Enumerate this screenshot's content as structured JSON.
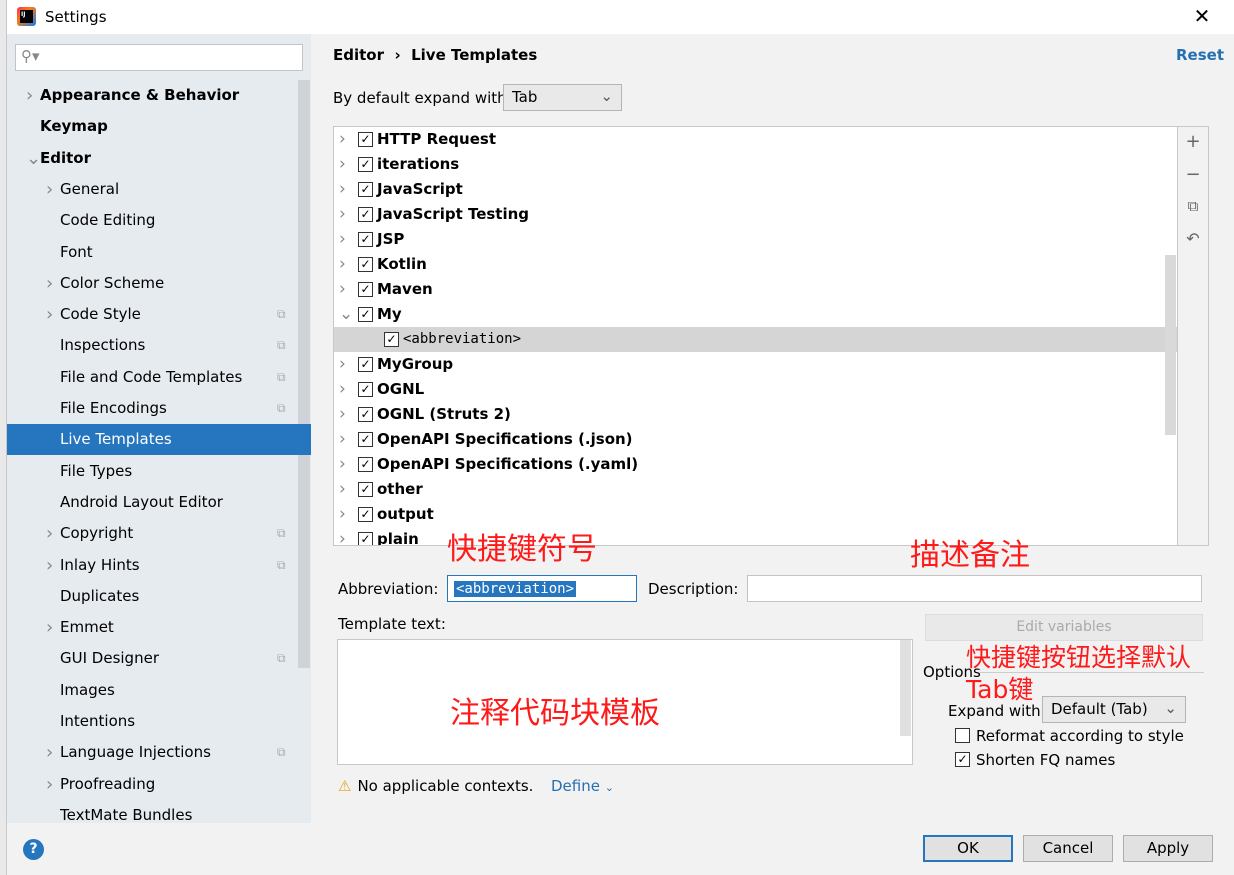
{
  "window": {
    "title": "Settings",
    "close": "✕"
  },
  "search": {
    "placeholder": "",
    "icon": "search-icon"
  },
  "sidebar": {
    "items": [
      {
        "label": "Appearance & Behavior",
        "level": 0,
        "bold": true,
        "arrow": "right"
      },
      {
        "label": "Keymap",
        "level": 0,
        "bold": true,
        "arrow": ""
      },
      {
        "label": "Editor",
        "level": 0,
        "bold": true,
        "arrow": "down"
      },
      {
        "label": "General",
        "level": 1,
        "arrow": "right"
      },
      {
        "label": "Code Editing",
        "level": 1,
        "arrow": ""
      },
      {
        "label": "Font",
        "level": 1,
        "arrow": ""
      },
      {
        "label": "Color Scheme",
        "level": 1,
        "arrow": "right"
      },
      {
        "label": "Code Style",
        "level": 1,
        "arrow": "right",
        "copy": true
      },
      {
        "label": "Inspections",
        "level": 1,
        "arrow": "",
        "copy": true
      },
      {
        "label": "File and Code Templates",
        "level": 1,
        "arrow": "",
        "copy": true
      },
      {
        "label": "File Encodings",
        "level": 1,
        "arrow": "",
        "copy": true
      },
      {
        "label": "Live Templates",
        "level": 1,
        "arrow": "",
        "selected": true
      },
      {
        "label": "File Types",
        "level": 1,
        "arrow": ""
      },
      {
        "label": "Android Layout Editor",
        "level": 1,
        "arrow": ""
      },
      {
        "label": "Copyright",
        "level": 1,
        "arrow": "right",
        "copy": true
      },
      {
        "label": "Inlay Hints",
        "level": 1,
        "arrow": "right",
        "copy": true
      },
      {
        "label": "Duplicates",
        "level": 1,
        "arrow": ""
      },
      {
        "label": "Emmet",
        "level": 1,
        "arrow": "right"
      },
      {
        "label": "GUI Designer",
        "level": 1,
        "arrow": "",
        "copy": true
      },
      {
        "label": "Images",
        "level": 1,
        "arrow": ""
      },
      {
        "label": "Intentions",
        "level": 1,
        "arrow": ""
      },
      {
        "label": "Language Injections",
        "level": 1,
        "arrow": "right",
        "copy": true
      },
      {
        "label": "Proofreading",
        "level": 1,
        "arrow": "right"
      },
      {
        "label": "TextMate Bundles",
        "level": 1,
        "arrow": ""
      }
    ]
  },
  "main": {
    "breadcrumb": [
      "Editor",
      "›",
      "Live Templates"
    ],
    "reset": "Reset",
    "expand_label": "By default expand with",
    "expand_value": "Tab",
    "tree": [
      {
        "label": "HTTP Request",
        "checked": true,
        "arrow": "right"
      },
      {
        "label": "iterations",
        "checked": true,
        "arrow": "right"
      },
      {
        "label": "JavaScript",
        "checked": true,
        "arrow": "right"
      },
      {
        "label": "JavaScript Testing",
        "checked": true,
        "arrow": "right"
      },
      {
        "label": "JSP",
        "checked": true,
        "arrow": "right"
      },
      {
        "label": "Kotlin",
        "checked": true,
        "arrow": "right"
      },
      {
        "label": "Maven",
        "checked": true,
        "arrow": "right"
      },
      {
        "label": "My",
        "checked": true,
        "arrow": "down"
      },
      {
        "label": "<abbreviation>",
        "checked": true,
        "arrow": "",
        "child": true,
        "selected": true
      },
      {
        "label": "MyGroup",
        "checked": true,
        "arrow": "right"
      },
      {
        "label": "OGNL",
        "checked": true,
        "arrow": "right"
      },
      {
        "label": "OGNL (Struts 2)",
        "checked": true,
        "arrow": "right"
      },
      {
        "label": "OpenAPI Specifications (.json)",
        "checked": true,
        "arrow": "right"
      },
      {
        "label": "OpenAPI Specifications (.yaml)",
        "checked": true,
        "arrow": "right"
      },
      {
        "label": "other",
        "checked": true,
        "arrow": "right"
      },
      {
        "label": "output",
        "checked": true,
        "arrow": "right"
      },
      {
        "label": "plain",
        "checked": true,
        "arrow": "right"
      }
    ],
    "tools": [
      "add-icon",
      "remove-icon",
      "copy-icon",
      "revert-icon"
    ],
    "abbreviation_label": "Abbreviation:",
    "abbreviation_value": "<abbreviation>",
    "description_label": "Description:",
    "description_value": "",
    "template_text_label": "Template text:",
    "template_text_value": "",
    "edit_variables": "Edit variables",
    "options_label": "Options",
    "expand_with_label": "Expand with",
    "expand_with_value": "Default (Tab)",
    "reformat_label": "Reformat according to style",
    "reformat_checked": false,
    "shorten_label": "Shorten FQ names",
    "shorten_checked": true,
    "warning": "No applicable contexts.",
    "define": "Define"
  },
  "annotations": {
    "a1": "快捷键符号",
    "a2": "描述备注",
    "a3": "快捷键按钮选择默认",
    "a3b": "Tab键",
    "a4": "注释代码块模板"
  },
  "footer": {
    "help": "?",
    "ok": "OK",
    "cancel": "Cancel",
    "apply": "Apply"
  }
}
